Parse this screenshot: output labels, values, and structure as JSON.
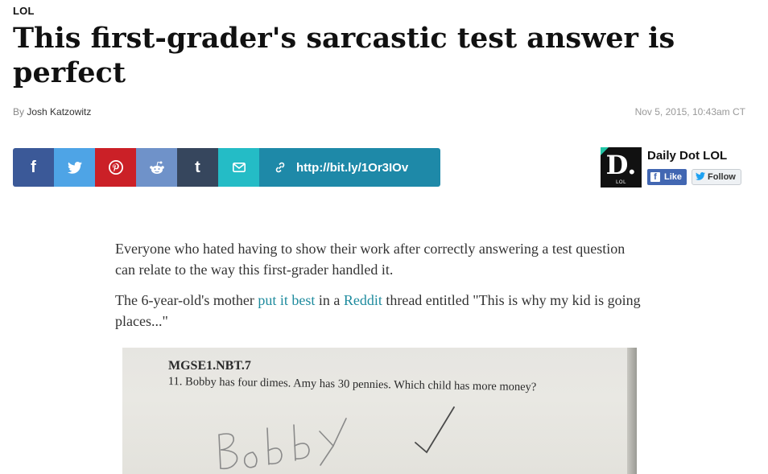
{
  "article": {
    "section": "LOL",
    "title": "This first-grader's sarcastic test answer is perfect",
    "byline_prefix": "By",
    "author": "Josh Katzowitz",
    "date": "Nov 5, 2015, 10:43am CT"
  },
  "share": {
    "buttons": [
      {
        "name": "facebook",
        "glyph": "f",
        "color": "#3b5998"
      },
      {
        "name": "twitter",
        "icon": "twitter-bird-icon",
        "color": "#4ea4e6"
      },
      {
        "name": "pinterest",
        "icon": "pinterest-icon",
        "color": "#cb2027"
      },
      {
        "name": "reddit",
        "icon": "reddit-alien-icon",
        "color": "#6f92c9"
      },
      {
        "name": "tumblr",
        "glyph": "t",
        "color": "#36465d"
      },
      {
        "name": "email",
        "icon": "envelope-icon",
        "color": "#24bcc6"
      }
    ],
    "short_link": "http://bit.ly/1Or3IOv",
    "link_color": "#1e89a8"
  },
  "brand": {
    "logo_letter": "D.",
    "logo_sub": "LOL",
    "name": "Daily Dot LOL",
    "fb_like_label": "Like",
    "tw_follow_label": "Follow",
    "accent": "#22c5a6"
  },
  "body": {
    "p1": "Everyone who hated having to show their work after correctly answering a test question can relate to the way this first-grader handled it.",
    "p2_before": "The 6-year-old's mother ",
    "p2_link1": "put it best",
    "p2_mid": " in a ",
    "p2_link2": "Reddit",
    "p2_after": " thread entitled \"This is why my kid is going places...\"",
    "link_color": "#1e8b9e"
  },
  "photo": {
    "standard": "MGSE1.NBT.7",
    "question": "11. Bobby has four dimes. Amy has 30 pennies. Which child has more money?",
    "handwritten_answer": "Bobby"
  }
}
